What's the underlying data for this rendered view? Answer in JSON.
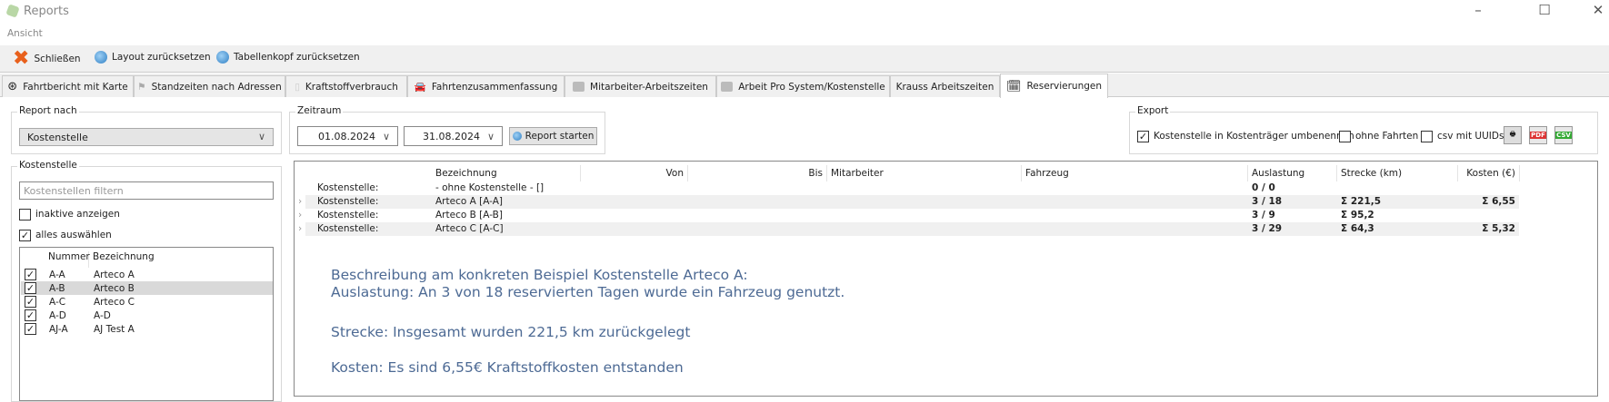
{
  "window": {
    "title": "Reports",
    "minimize": "–",
    "maximize": "☐",
    "close": "✕"
  },
  "menu": {
    "view": "Ansicht"
  },
  "toolbar": {
    "close": "Schließen",
    "reset_layout": "Layout zurücksetzen",
    "reset_header": "Tabellenkopf zurücksetzen"
  },
  "tabs": [
    {
      "label": "Fahrtbericht mit Karte",
      "icon": "steering-wheel-icon"
    },
    {
      "label": "Standzeiten nach Adressen",
      "icon": "flag-icon"
    },
    {
      "label": "Kraftstoffverbrauch",
      "icon": "fuel-icon"
    },
    {
      "label": "Fahrtenzusammenfassung",
      "icon": "car-icon"
    },
    {
      "label": "Mitarbeiter-Arbeitszeiten",
      "icon": "id-card-icon"
    },
    {
      "label": "Arbeit Pro System/Kostenstelle",
      "icon": "id-card-icon"
    },
    {
      "label": "Krauss Arbeitszeiten",
      "icon": ""
    },
    {
      "label": "Reservierungen",
      "icon": "calendar-check-icon",
      "active": true
    }
  ],
  "report_by": {
    "label": "Report nach",
    "value": "Kostenstelle"
  },
  "period": {
    "label": "Zeitraum",
    "from": "01.08.2024",
    "to": "31.08.2024",
    "start_button": "Report starten"
  },
  "export": {
    "label": "Export",
    "rename": "Kostenstelle in Kostenträger umbenennen",
    "rename_checked": true,
    "no_trips": "ohne Fahrten",
    "no_trips_checked": false,
    "csv_uuids": "csv mit UUIDs",
    "csv_uuids_checked": false,
    "print": "print-icon",
    "pdf": "PDF",
    "csv": "CSV"
  },
  "cost_centers": {
    "label": "Kostenstelle",
    "filter_placeholder": "Kostenstellen filtern",
    "show_inactive": "inaktive anzeigen",
    "show_inactive_checked": false,
    "select_all": "alles auswählen",
    "select_all_checked": true,
    "columns": [
      "Nummer",
      "Bezeichnung"
    ],
    "rows": [
      {
        "number": "A-A",
        "name": "Arteco A",
        "checked": true
      },
      {
        "number": "A-B",
        "name": "Arteco B",
        "checked": true,
        "selected": true
      },
      {
        "number": "A-C",
        "name": "Arteco C",
        "checked": true
      },
      {
        "number": "A-D",
        "name": "A-D",
        "checked": true
      },
      {
        "number": "AJ-A",
        "name": "AJ Test A",
        "checked": true
      }
    ]
  },
  "grid": {
    "columns": [
      "Bezeichnung",
      "Von",
      "Bis",
      "Mitarbeiter",
      "Fahrzeug",
      "Auslastung",
      "Strecke (km)",
      "Kosten (€)"
    ],
    "rows": [
      {
        "group": "Kostenstelle:",
        "name": "- ohne Kostenstelle - []",
        "utilization": "0 / 0",
        "distance": "",
        "cost": "",
        "expandable": false
      },
      {
        "group": "Kostenstelle:",
        "name": "Arteco A [A-A]",
        "utilization": "3 / 18",
        "distance": "Σ 221,5",
        "cost": "Σ 6,55",
        "expandable": true
      },
      {
        "group": "Kostenstelle:",
        "name": "Arteco B [A-B]",
        "utilization": "3 / 9",
        "distance": "Σ 95,2",
        "cost": "",
        "expandable": true
      },
      {
        "group": "Kostenstelle:",
        "name": "Arteco C [A-C]",
        "utilization": "3 / 29",
        "distance": "Σ 64,3",
        "cost": "Σ 5,32",
        "expandable": true
      }
    ]
  },
  "description": [
    "Beschreibung am konkreten Beispiel Kostenstelle Arteco A:",
    "Auslastung: An 3 von 18 reservierten Tagen wurde ein Fahrzeug genutzt.",
    "Strecke: Insgesamt wurden 221,5 km zurückgelegt",
    "Kosten: Es sind 6,55€ Kraftstoffkosten entstanden"
  ]
}
